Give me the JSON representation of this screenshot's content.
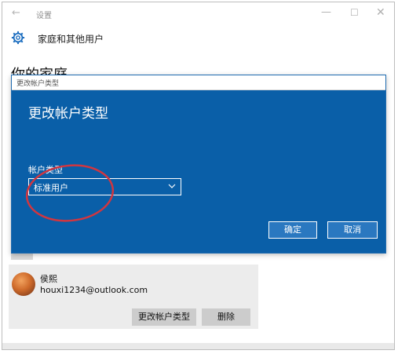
{
  "window": {
    "title": "设置",
    "back_icon": "back-arrow-icon",
    "controls": [
      "minimize-icon",
      "maximize-icon",
      "close-icon"
    ]
  },
  "header": {
    "icon": "gear-icon",
    "section_title": "家庭和其他用户"
  },
  "page": {
    "heading": "你的家庭"
  },
  "user": {
    "name": "侯熙",
    "email": "houxi1234@outlook.com",
    "change_type_label": "更改帐户类型",
    "delete_label": "删除"
  },
  "dialog": {
    "window_title": "更改帐户类型",
    "heading": "更改帐户类型",
    "field_label": "帐户类型",
    "selected_value": "标准用户",
    "ok_label": "确定",
    "cancel_label": "取消",
    "background_color": "#0a5fa8"
  },
  "annotation": {
    "color": "#d2363f"
  }
}
